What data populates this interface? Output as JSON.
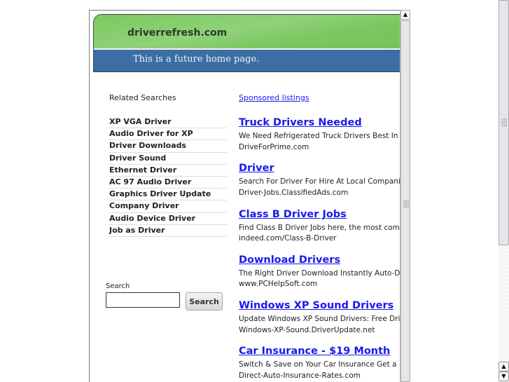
{
  "header": {
    "site": "driverrefresh.com",
    "tagline": "This is a future home page."
  },
  "related": {
    "title": "Related Searches",
    "items": [
      "XP VGA Driver",
      "Audio Driver for XP",
      "Driver Downloads",
      "Driver Sound",
      "Ethernet Driver",
      "AC 97 Audio Driver",
      "Graphics Driver Update",
      "Company Driver",
      "Audio Device Driver",
      "Job as Driver"
    ]
  },
  "search": {
    "label": "Search",
    "value": "",
    "button": "Search"
  },
  "sponsored": {
    "label": "Sponsored listings",
    "ads": [
      {
        "title": "Truck Drivers Needed",
        "desc": "We Need Refrigerated Truck Drivers Best In Th",
        "url": "DriveForPrime.com"
      },
      {
        "title": "Driver",
        "desc": "Search For Driver For Hire At Local Companies",
        "url": "Driver-Jobs.ClassifiedAds.com"
      },
      {
        "title": "Class B Driver Jobs",
        "desc": "Find Class B Driver Jobs here, the most comple",
        "url": "indeed.com/Class-B-Driver"
      },
      {
        "title": "Download Drivers",
        "desc": "The Right Driver Download Instantly Auto-Drive",
        "url": "www.PCHelpSoft.com"
      },
      {
        "title": "Windows XP Sound Drivers",
        "desc": "Update Windows XP Sound Drivers: Free Drive",
        "url": "Windows-XP-Sound.DriverUpdate.net"
      },
      {
        "title": "Car Insurance - $19 Month",
        "desc": "Switch & Save on Your Car Insurance Get a Fre",
        "url": "Direct-Auto-Insurance-Rates.com"
      }
    ]
  }
}
